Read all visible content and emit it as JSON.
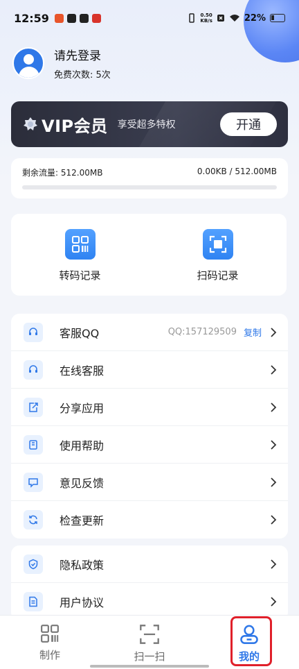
{
  "status_bar": {
    "time": "12:59",
    "net_speed_value": "0.50",
    "net_speed_unit": "KB/s",
    "battery": "22%"
  },
  "profile": {
    "title": "请先登录",
    "free_count": "免费次数: 5次"
  },
  "vip": {
    "title": "VIP会员",
    "subtitle": "享受超多特权",
    "button": "开通"
  },
  "traffic": {
    "remaining": "剩余流量: 512.00MB",
    "usage": "0.00KB / 512.00MB",
    "used_fraction": 0
  },
  "records": [
    {
      "label": "转码记录",
      "icon": "qr-code-grid-icon"
    },
    {
      "label": "扫码记录",
      "icon": "scan-frame-icon"
    }
  ],
  "menu1": [
    {
      "label": "客服QQ",
      "icon": "headset-icon",
      "extra": "QQ:157129509",
      "link": "复制"
    },
    {
      "label": "在线客服",
      "icon": "headset-icon"
    },
    {
      "label": "分享应用",
      "icon": "share-icon"
    },
    {
      "label": "使用帮助",
      "icon": "help-book-icon"
    },
    {
      "label": "意见反馈",
      "icon": "feedback-chat-icon"
    },
    {
      "label": "检查更新",
      "icon": "refresh-icon"
    }
  ],
  "menu2": [
    {
      "label": "隐私政策",
      "icon": "shield-check-icon"
    },
    {
      "label": "用户协议",
      "icon": "document-icon"
    }
  ],
  "bottom_nav": [
    {
      "label": "制作",
      "icon": "qr-code-grid-icon"
    },
    {
      "label": "扫一扫",
      "icon": "scan-frame-icon"
    },
    {
      "label": "我的",
      "icon": "user-icon",
      "active": true
    }
  ],
  "colors": {
    "accent": "#2f78e8",
    "vip_bg": "#2b2d3a",
    "highlight_outline": "#e0202a"
  }
}
